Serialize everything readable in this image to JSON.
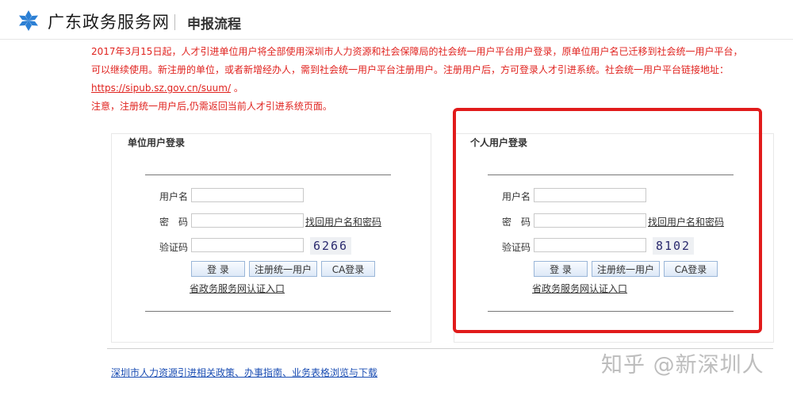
{
  "header": {
    "site_name": "广东政务服务网",
    "page_title": "申报流程"
  },
  "notice": {
    "line1": "2017年3月15日起，人才引进单位用户将全部使用深圳市人力资源和社会保障局的社会统一用户平台用户登录，原单位用户名已迁移到社会统一用户平台，可以继续使用。新注册的单位，或者新增经办人，需到社会统一用户平台注册用户。注册用户后，方可登录人才引进系统。社会统一用户平台链接地址：",
    "url": "https://sipub.sz.gov.cn/suum/",
    "url_suffix": "。",
    "line2": "注意，注册统一用户后,仍需返回当前人才引进系统页面。"
  },
  "unit_login": {
    "title": "单位用户登录",
    "username_label": "用户名",
    "password_label": "密　码",
    "captcha_label": "验证码",
    "find_link": "找回用户名和密码",
    "captcha_code": "6266",
    "login_button": "登 录",
    "register_button": "注册统一用户",
    "ca_button": "CA登录",
    "gov_link": "省政务服务网认证入口"
  },
  "person_login": {
    "title": "个人用户登录",
    "username_label": "用户名",
    "password_label": "密　码",
    "captcha_label": "验证码",
    "find_link": "找回用户名和密码",
    "captcha_code": "8102",
    "login_button": "登 录",
    "register_button": "注册统一用户",
    "ca_button": "CA登录",
    "gov_link": "省政务服务网认证入口"
  },
  "footer": {
    "link": "深圳市人力资源引进相关政策、办事指南、业务表格浏览与下载"
  },
  "watermark": "知乎 @新深圳人",
  "colors": {
    "notice_red": "#e0231f",
    "highlight_red": "#e11b1b",
    "link_blue": "#1a4db3",
    "logo_blue": "#2b7fd4"
  }
}
